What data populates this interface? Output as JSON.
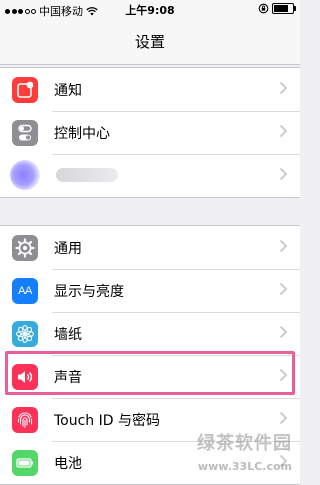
{
  "status_bar": {
    "carrier": "中国移动",
    "time": "上午9:08",
    "battery_level": 0.8
  },
  "nav": {
    "title": "设置"
  },
  "section1": {
    "items": [
      {
        "label": "通知",
        "icon": "notifications-icon",
        "color": "#fc3d39"
      },
      {
        "label": "控制中心",
        "icon": "control-center-icon",
        "color": "#8e8e93"
      }
    ]
  },
  "section2": {
    "items": [
      {
        "label": "通用",
        "icon": "gear-icon",
        "color": "#8e8e93"
      },
      {
        "label": "显示与亮度",
        "icon": "display-brightness-icon",
        "color": "#147efb",
        "glyph": "AA"
      },
      {
        "label": "墙纸",
        "icon": "wallpaper-icon",
        "color": "#35aadc"
      },
      {
        "label": "声音",
        "icon": "sound-icon",
        "color": "#fc3158"
      },
      {
        "label": "Touch ID 与密码",
        "icon": "fingerprint-icon",
        "color": "#fc3158"
      },
      {
        "label": "电池",
        "icon": "battery-icon",
        "color": "#53d769"
      }
    ]
  },
  "watermark": {
    "text": "绿茶软件园",
    "url": "www.33LC.com"
  }
}
